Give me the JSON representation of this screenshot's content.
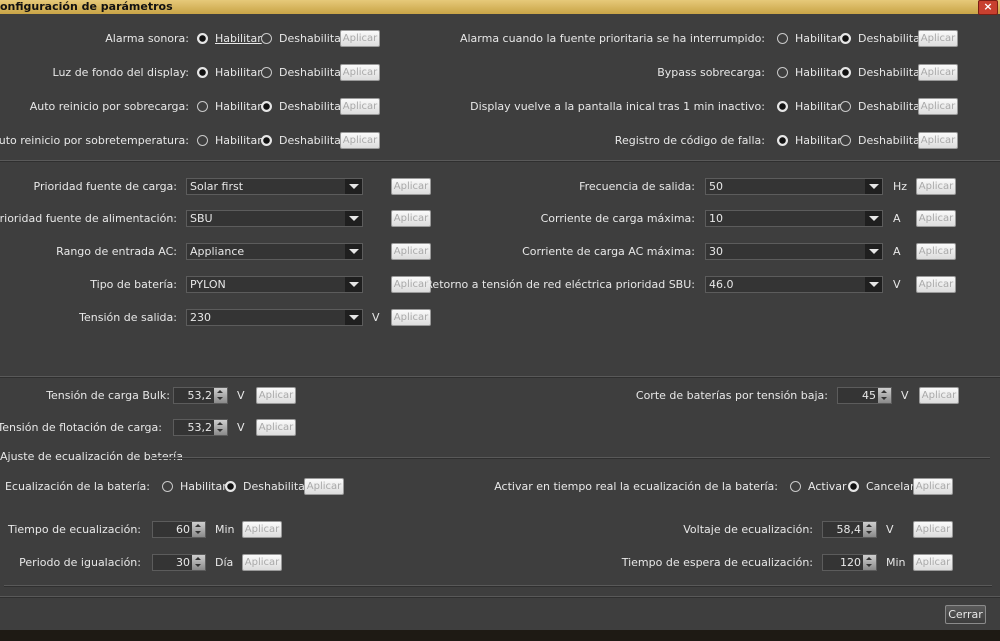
{
  "window": {
    "title": "onfiguración de parámetros",
    "close_glyph": "×"
  },
  "common": {
    "habilitar": "Habilitar",
    "deshabilitar": "Deshabilitar",
    "aplicar": "Aplicar"
  },
  "alarms_left": [
    {
      "label": "Alarma sonora:",
      "selected": "habilitar"
    },
    {
      "label": "Luz de fondo del display:",
      "selected": "habilitar"
    },
    {
      "label": "Auto reinicio por sobrecarga:",
      "selected": "deshabilitar"
    },
    {
      "label": "Auto reinicio por sobretemperatura:",
      "selected": "deshabilitar"
    }
  ],
  "alarms_right": [
    {
      "label": "Alarma cuando la fuente prioritaria se ha interrumpido:",
      "selected": "deshabilitar"
    },
    {
      "label": "Bypass sobrecarga:",
      "selected": "deshabilitar"
    },
    {
      "label": "Display vuelve a la pantalla inical tras 1 min inactivo:",
      "selected": "habilitar"
    },
    {
      "label": "Registro de código de falla:",
      "selected": "habilitar"
    }
  ],
  "selects_left": [
    {
      "label": "Prioridad fuente de carga:",
      "value": "Solar first",
      "unit": ""
    },
    {
      "label": "Prioridad fuente de alimentación:",
      "value": "SBU",
      "unit": ""
    },
    {
      "label": "Rango de entrada AC:",
      "value": "Appliance",
      "unit": ""
    },
    {
      "label": "Tipo de batería:",
      "value": "PYLON",
      "unit": ""
    },
    {
      "label": "Tensión de salida:",
      "value": "230",
      "unit": "V"
    }
  ],
  "selects_right": [
    {
      "label": "Frecuencia de salida:",
      "value": "50",
      "unit": "Hz"
    },
    {
      "label": "Corriente de carga máxima:",
      "value": "10",
      "unit": "A"
    },
    {
      "label": "Corriente de carga AC máxima:",
      "value": "30",
      "unit": "A"
    },
    {
      "label": "Retorno a tensión de red eléctrica prioridad SBU:",
      "value": "46.0",
      "unit": "V"
    }
  ],
  "voltages": {
    "bulk": {
      "label": "Tensión de carga Bulk:",
      "value": "53,2",
      "unit": "V"
    },
    "float": {
      "label": "Tensión de flotación de carga:",
      "value": "53,2",
      "unit": "V"
    },
    "cutoff": {
      "label": "Corte de baterías por tensión baja:",
      "value": "45",
      "unit": "V"
    }
  },
  "equalization": {
    "section_title": "Ajuste de ecualización de batería",
    "enable": {
      "label": "Ecualización de la batería:",
      "selected": "deshabilitar"
    },
    "realtime": {
      "label": "Activar en tiempo real la ecualización de la batería:",
      "option_a": "Activar",
      "option_b": "Cancelar",
      "selected": "cancelar"
    },
    "time": {
      "label": "Tiempo de ecualización:",
      "value": "60",
      "unit": "Min"
    },
    "period": {
      "label": "Periodo de igualación:",
      "value": "30",
      "unit": "Día"
    },
    "voltage": {
      "label": "Voltaje de ecualización:",
      "value": "58,4",
      "unit": "V"
    },
    "timeout": {
      "label": "Tiempo de espera de ecualización:",
      "value": "120",
      "unit": "Min"
    }
  },
  "footer": {
    "close_label": "Cerrar"
  }
}
